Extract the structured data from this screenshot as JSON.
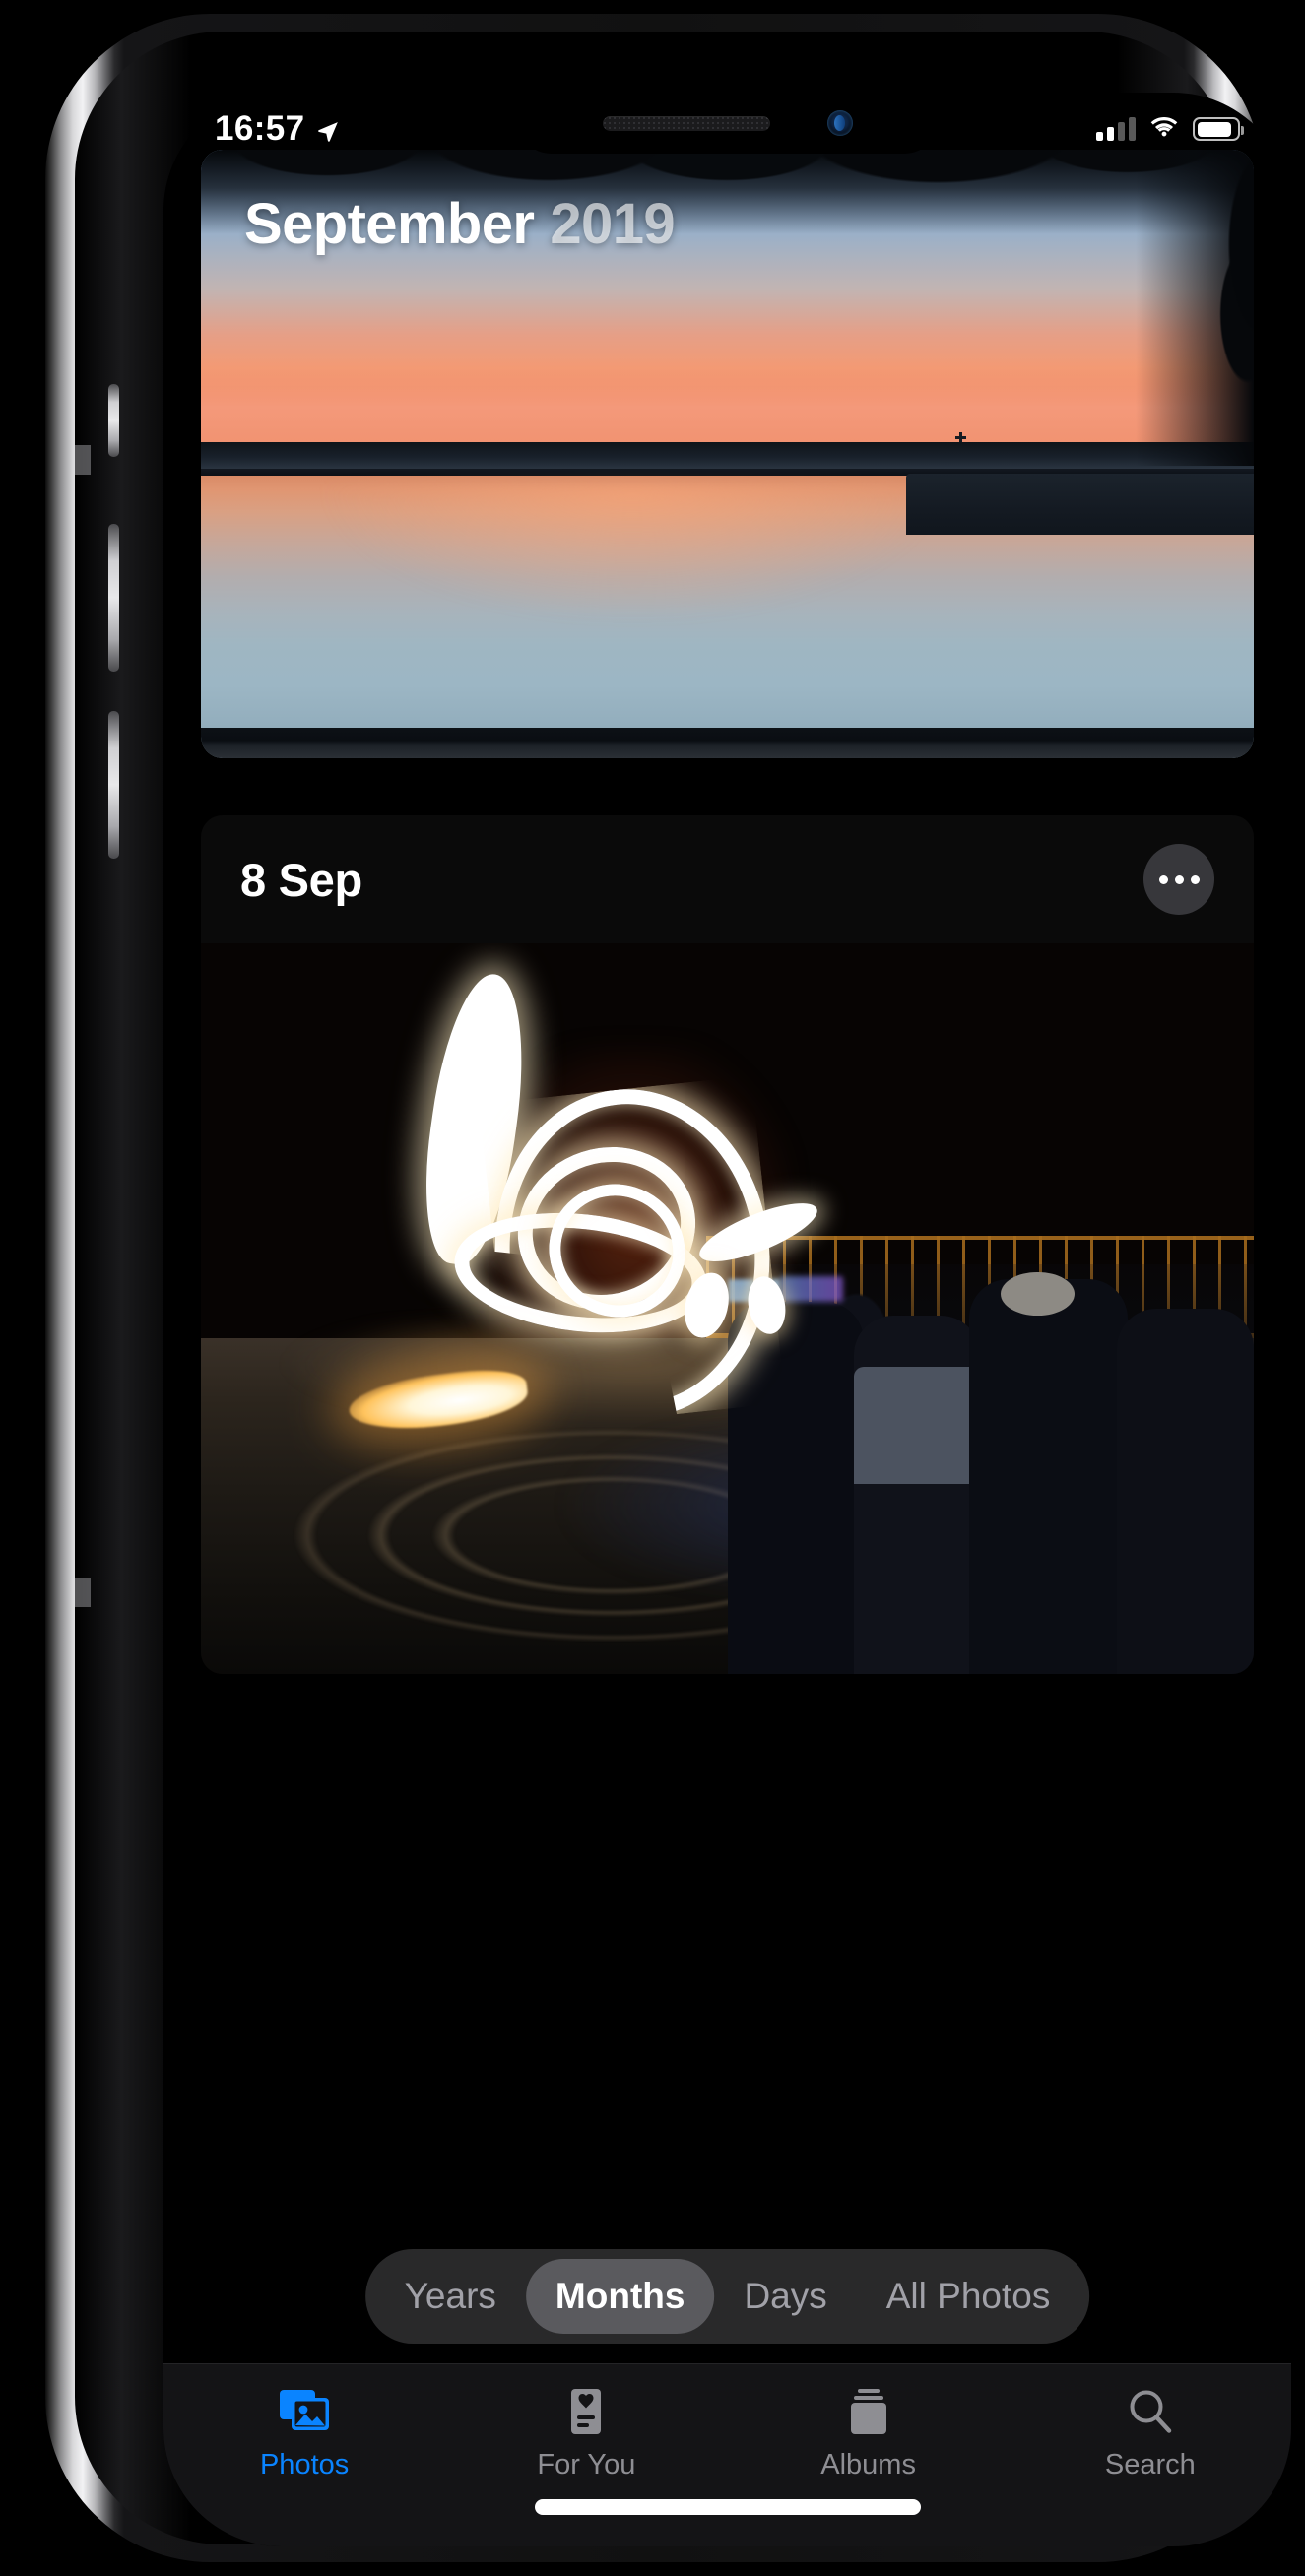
{
  "status_bar": {
    "time": "16:57",
    "location_icon": "location-arrow-icon",
    "signal_icon": "cellular-signal-icon",
    "signal_bars_filled": 2,
    "signal_bars_total": 4,
    "wifi_icon": "wifi-icon",
    "battery_icon": "battery-icon",
    "battery_level_percent": 88
  },
  "month_card": {
    "month": "September",
    "year": "2019",
    "photo_description": "sunset-over-lake"
  },
  "day_card": {
    "date": "8 Sep",
    "more_icon": "ellipsis-icon",
    "photo_description": "fire-performance-at-night"
  },
  "segmented_control": {
    "options": [
      "Years",
      "Months",
      "Days",
      "All Photos"
    ],
    "selected": "Months"
  },
  "tab_bar": {
    "tabs": [
      {
        "label": "Photos",
        "icon": "photos-stack-icon",
        "active": true
      },
      {
        "label": "For You",
        "icon": "for-you-heart-card-icon",
        "active": false
      },
      {
        "label": "Albums",
        "icon": "albums-stack-icon",
        "active": false
      },
      {
        "label": "Search",
        "icon": "magnifying-glass-icon",
        "active": false
      }
    ]
  },
  "colors": {
    "accent": "#0A84FF",
    "inactive_tab": "#8E8E93",
    "segment_track": "#2C2C2E",
    "segment_selected": "#5A5A5E",
    "tabbar_bg": "#141416",
    "screen_bg": "#000000"
  }
}
